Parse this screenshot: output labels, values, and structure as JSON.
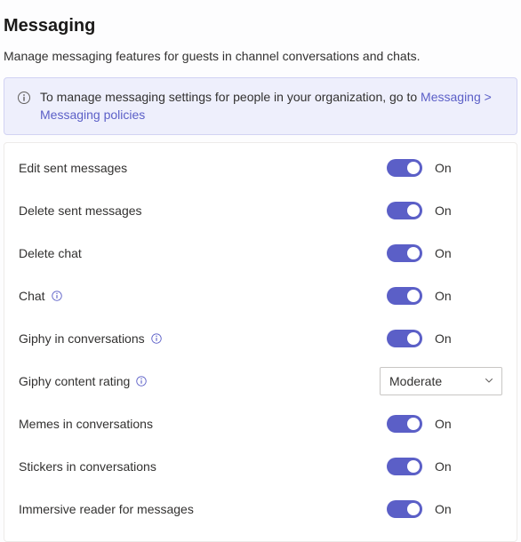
{
  "heading": "Messaging",
  "description": "Manage messaging features for guests in channel conversations and chats.",
  "banner": {
    "text_before_link": "To manage messaging settings for people in your organization, go to ",
    "link_text": "Messaging > Messaging policies"
  },
  "toggle_on_label": "On",
  "settings": [
    {
      "key": "edit_sent_messages",
      "label": "Edit sent messages",
      "type": "toggle",
      "value": "On",
      "help": false
    },
    {
      "key": "delete_sent_messages",
      "label": "Delete sent messages",
      "type": "toggle",
      "value": "On",
      "help": false
    },
    {
      "key": "delete_chat",
      "label": "Delete chat",
      "type": "toggle",
      "value": "On",
      "help": false
    },
    {
      "key": "chat",
      "label": "Chat",
      "type": "toggle",
      "value": "On",
      "help": true
    },
    {
      "key": "giphy_in_conversations",
      "label": "Giphy in conversations",
      "type": "toggle",
      "value": "On",
      "help": true
    },
    {
      "key": "giphy_content_rating",
      "label": "Giphy content rating",
      "type": "dropdown",
      "value": "Moderate",
      "help": true
    },
    {
      "key": "memes_in_conversations",
      "label": "Memes in conversations",
      "type": "toggle",
      "value": "On",
      "help": false
    },
    {
      "key": "stickers_in_conversations",
      "label": "Stickers in conversations",
      "type": "toggle",
      "value": "On",
      "help": false
    },
    {
      "key": "immersive_reader_for_messages",
      "label": "Immersive reader for messages",
      "type": "toggle",
      "value": "On",
      "help": false
    }
  ]
}
